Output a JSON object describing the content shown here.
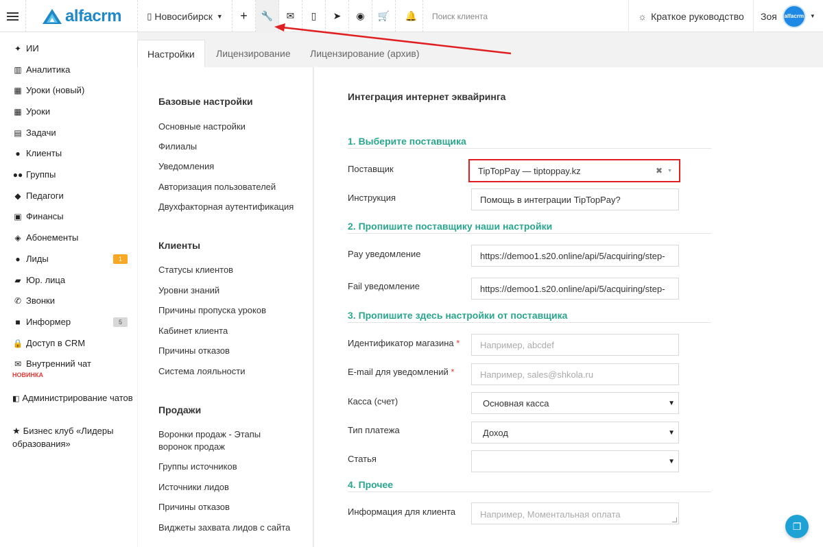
{
  "topbar": {
    "logo_text": "alfacrm",
    "branch": "Новосибирск",
    "search_placeholder": "Поиск клиента",
    "guide": "Краткое руководство",
    "user_name": "Зоя",
    "avatar_text": "alfacrm",
    "icons": [
      "plus-icon",
      "wrench-icon",
      "mail-icon",
      "phone-icon",
      "telegram-icon",
      "whatsapp-icon",
      "cart-icon",
      "bell-icon"
    ]
  },
  "sidebar": {
    "items": [
      {
        "label": "ИИ",
        "icon": "sparkle-icon"
      },
      {
        "label": "Аналитика",
        "icon": "library-icon"
      },
      {
        "label": "Уроки (новый)",
        "icon": "calendar-icon"
      },
      {
        "label": "Уроки",
        "icon": "calendar-icon"
      },
      {
        "label": "Задачи",
        "icon": "clipboard-icon"
      },
      {
        "label": "Клиенты",
        "icon": "user-icon"
      },
      {
        "label": "Группы",
        "icon": "users-icon"
      },
      {
        "label": "Педагоги",
        "icon": "graduation-cap-icon"
      },
      {
        "label": "Финансы",
        "icon": "money-icon"
      },
      {
        "label": "Абонементы",
        "icon": "tag-icon"
      },
      {
        "label": "Лиды",
        "icon": "user-plus-icon",
        "badge": "1"
      },
      {
        "label": "Юр. лица",
        "icon": "briefcase-icon"
      },
      {
        "label": "Звонки",
        "icon": "phone-icon"
      },
      {
        "label": "Информер",
        "icon": "monitor-icon",
        "badge": "5"
      },
      {
        "label": "Доступ в CRM",
        "icon": "lock-icon"
      },
      {
        "label": "Внутренний чат",
        "icon": "envelope-icon"
      }
    ],
    "new_label": "НОВИНКА",
    "admin_chats": "Администрирование чатов",
    "business_club": "Бизнес клуб «Лидеры образования»"
  },
  "tabs": [
    "Настройки",
    "Лицензирование",
    "Лицензирование (архив)"
  ],
  "menu": {
    "sections": [
      {
        "title": "Базовые настройки",
        "items": [
          "Основные настройки",
          "Филиалы",
          "Уведомления",
          "Авторизация пользователей",
          "Двухфакторная аутентификация"
        ]
      },
      {
        "title": "Клиенты",
        "items": [
          "Статусы клиентов",
          "Уровни знаний",
          "Причины пропуска уроков",
          "Кабинет клиента",
          "Причины отказов",
          "Система лояльности"
        ]
      },
      {
        "title": "Продажи",
        "items": [
          "Воронки продаж - Этапы воронок продаж",
          "Группы источников",
          "Источники лидов",
          "Причины отказов",
          "Виджеты захвата лидов с сайта"
        ]
      }
    ]
  },
  "form": {
    "title": "Интеграция интернет эквайринга",
    "sections": [
      "1. Выберите поставщика",
      "2. Пропишите поставщику наши настройки",
      "3. Пропишите здесь настройки от поставщика",
      "4. Прочее"
    ],
    "provider_label": "Поставщик",
    "provider_value": "TipTopPay — tiptoppay.kz",
    "instruction_label": "Инструкция",
    "instruction_value": "Помощь в интеграции TipTopPay?",
    "pay_label": "Pay уведомление",
    "pay_value": "https://demoo1.s20.online/api/5/acquiring/step-",
    "fail_label": "Fail уведомление",
    "fail_value": "https://demoo1.s20.online/api/5/acquiring/step-",
    "shop_id_label": "Идентификатор магазина",
    "shop_id_placeholder": "Например, abcdef",
    "email_label": "E-mail для уведомлений",
    "email_placeholder": "Например, sales@shkola.ru",
    "cash_label": "Касса (счет)",
    "cash_value": "Основная касса",
    "payment_type_label": "Тип платежа",
    "payment_type_value": "Доход",
    "article_label": "Статья",
    "article_value": "",
    "client_info_label": "Информация для клиента",
    "client_info_placeholder": "Например, Моментальная оплата",
    "required_mark": "*"
  },
  "colors": {
    "accent_green": "#2aa68f",
    "highlight_red": "#e02020",
    "brand_blue": "#1e88c8",
    "badge_orange": "#f9a825"
  }
}
